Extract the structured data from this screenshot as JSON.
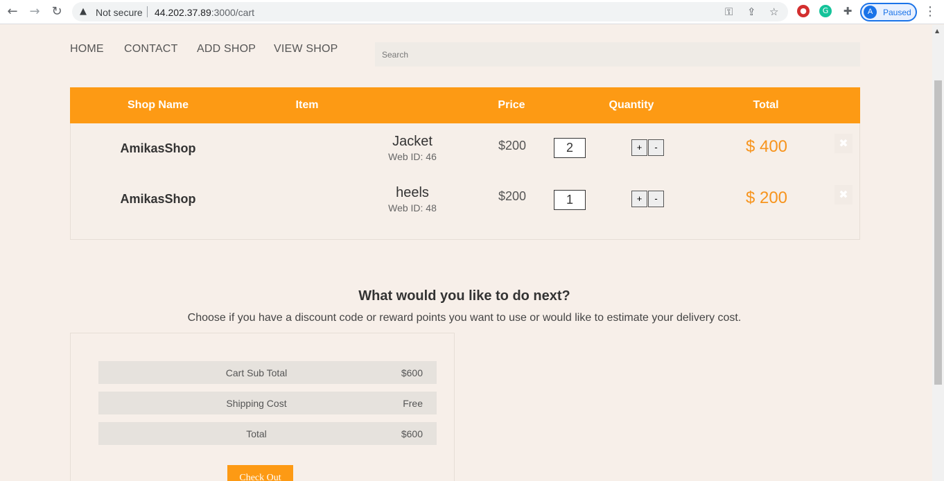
{
  "browser": {
    "back_icon": "←",
    "forward_icon": "→",
    "reload_icon": "↻",
    "security_label": "Not secure",
    "url_host": "44.202.37.89",
    "url_path": ":3000/cart",
    "key_icon": "⚿",
    "share_icon": "⇪",
    "star_icon": "☆",
    "profile_initial": "A",
    "profile_status": "Paused",
    "menu_icon": "⋮"
  },
  "nav": {
    "home": "HOME",
    "contact": "CONTACT",
    "add_shop": "ADD SHOP",
    "view_shop": "VIEW SHOP"
  },
  "search": {
    "placeholder": "Search"
  },
  "cart": {
    "headers": {
      "shop_name": "Shop Name",
      "item": "Item",
      "price": "Price",
      "quantity": "Quantity",
      "total": "Total"
    },
    "rows": [
      {
        "shop": "AmikasShop",
        "item": "Jacket",
        "web_id": "Web ID: 46",
        "price": "$200",
        "quantity": "2",
        "total": "$ 400"
      },
      {
        "shop": "AmikasShop",
        "item": "heels",
        "web_id": "Web ID: 48",
        "price": "$200",
        "quantity": "1",
        "total": "$ 200"
      }
    ],
    "plus_label": "+",
    "minus_label": "-",
    "remove_icon": "✖"
  },
  "next": {
    "title": "What would you like to do next?",
    "subtitle": "Choose if you have a discount code or reward points you want to use or would like to estimate your delivery cost."
  },
  "summary": {
    "rows": [
      {
        "label": "Cart Sub Total",
        "value": "$600"
      },
      {
        "label": "Shipping Cost",
        "value": "Free"
      },
      {
        "label": "Total",
        "value": "$600"
      }
    ],
    "checkout_label": "Check Out"
  }
}
